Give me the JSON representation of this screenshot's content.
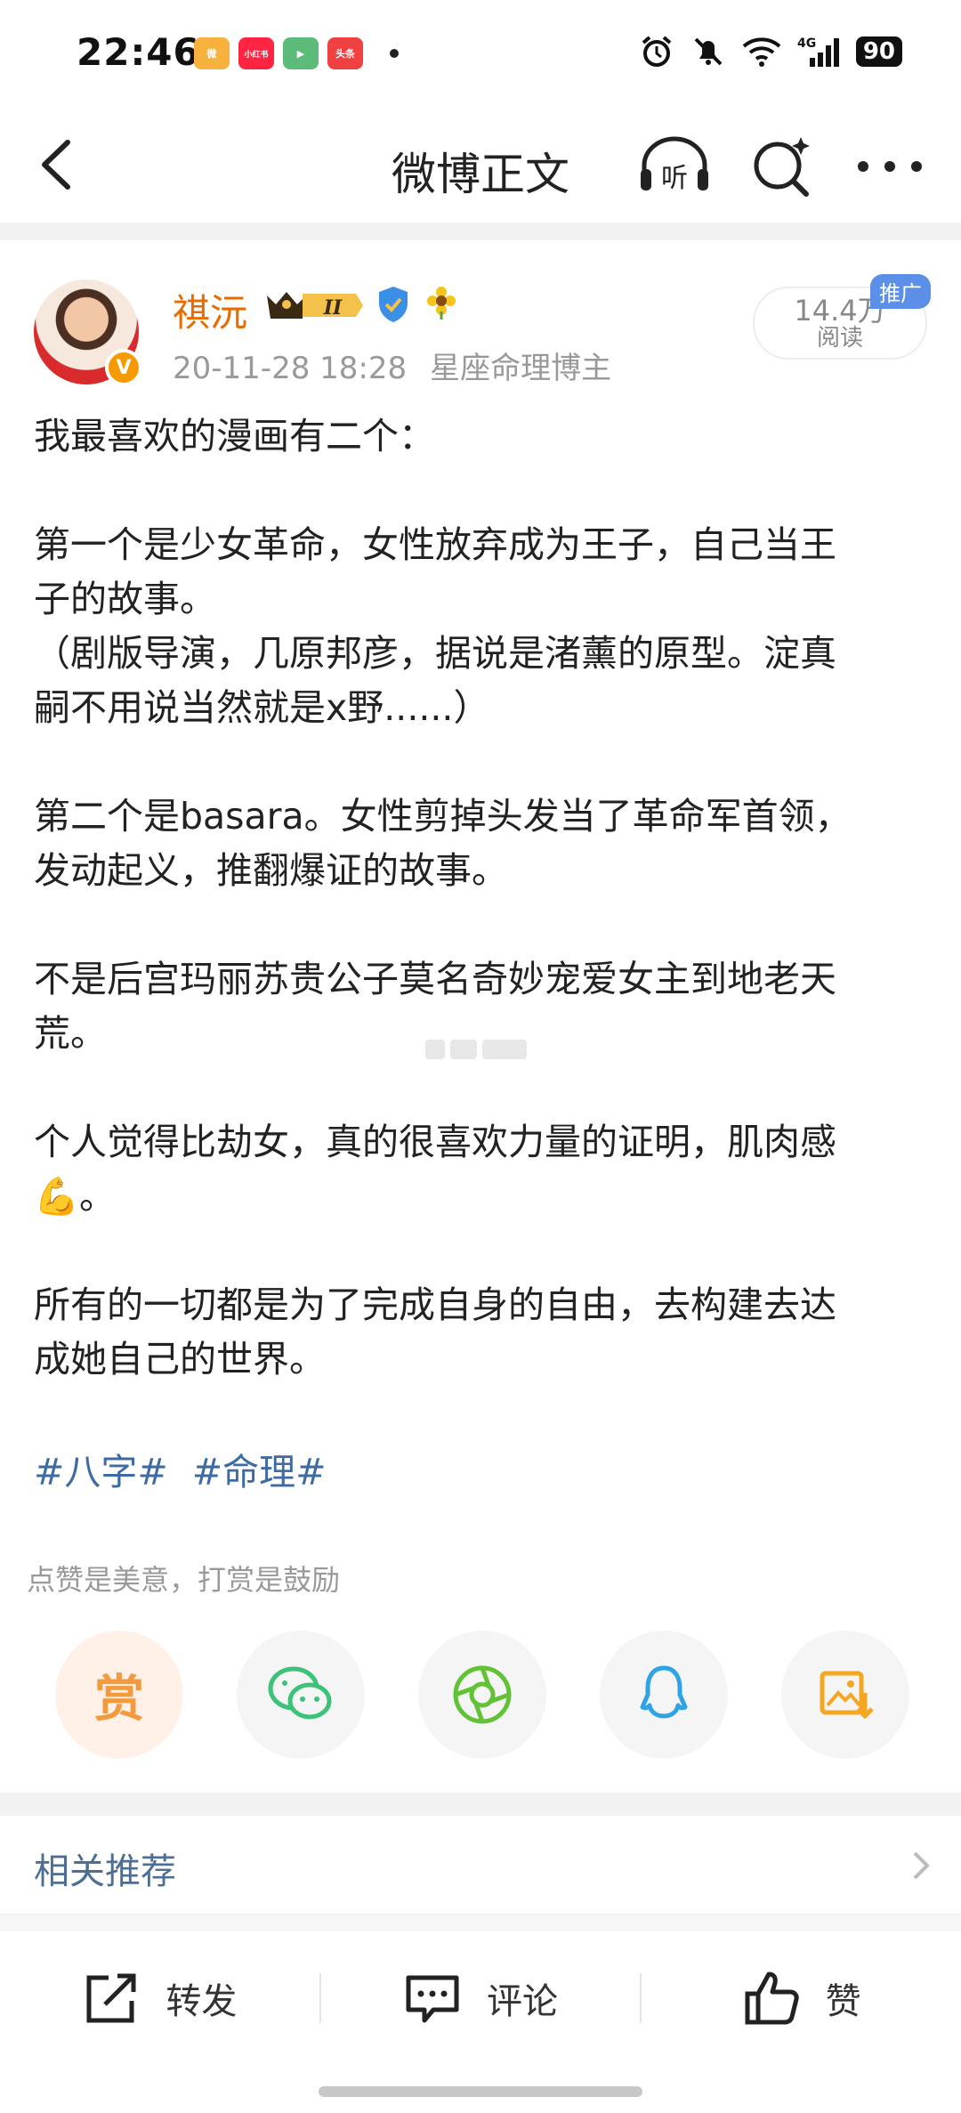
{
  "status_bar": {
    "time": "22:46",
    "app_badges": [
      {
        "label": "微",
        "color": "#f6b23c"
      },
      {
        "label": "小红书",
        "color": "#ff2442"
      },
      {
        "label": "▶",
        "color": "#5dbb7a"
      },
      {
        "label": "头条",
        "color": "#f04142"
      }
    ],
    "battery": "90",
    "network": "4G"
  },
  "nav": {
    "title": "微博正文",
    "listen_label": "听"
  },
  "post": {
    "author": "祺沅",
    "timestamp": "20-11-28 18:28",
    "source": "星座命理博主",
    "reads_count": "14.4万",
    "reads_label": "阅读",
    "ad_tag": "推广",
    "verified_badge": "V",
    "paragraphs": [
      "我最喜欢的漫画有二个：",
      "",
      "第一个是少女革命，女性放弃成为王子，自己当王",
      "子的故事。",
      "（剧版导演，几原邦彦，据说是渚薰的原型。淀真",
      "嗣不用说当然就是x野......）",
      "",
      "第二个是basara。女性剪掉头发当了革命军首领，",
      "发动起义，推翻爆证的故事。",
      "",
      "不是后宫玛丽苏贵公子莫名奇妙宠爱女主到地老天",
      "荒。",
      "",
      "个人觉得比劫女，真的很喜欢力量的证明，肌肉感",
      "💪。",
      "",
      "所有的一切都是为了完成自身的自由，去构建去达",
      "成她自己的世界。"
    ],
    "tags": [
      "#八字#",
      "#命理#"
    ]
  },
  "reward": {
    "hint": "点赞是美意，打赏是鼓励",
    "reward_label": "赏"
  },
  "related": {
    "label": "相关推荐"
  },
  "toolbar": {
    "repost": "转发",
    "comment": "评论",
    "like": "赞"
  },
  "colors": {
    "accent_orange": "#e86b00",
    "link_blue": "#3f6ba3",
    "wechat_green": "#3dc27a",
    "moments_green": "#62c236",
    "qq_blue": "#2fa3e6",
    "save_yellow": "#f5a623"
  }
}
